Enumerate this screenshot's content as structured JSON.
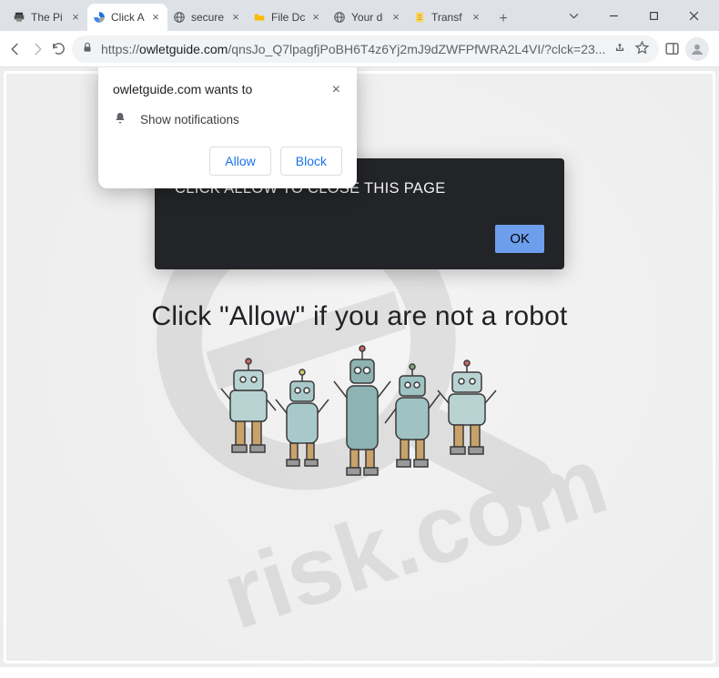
{
  "window": {
    "tabs": [
      {
        "title": "The Pi",
        "favicon": "printer"
      },
      {
        "title": "Click A",
        "favicon": "recaptcha",
        "active": true
      },
      {
        "title": "secure",
        "favicon": "globe"
      },
      {
        "title": "File Dc",
        "favicon": "folder"
      },
      {
        "title": "Your d",
        "favicon": "globe"
      },
      {
        "title": "Transf",
        "favicon": "sheet"
      }
    ],
    "controls": {
      "minimize": "–",
      "maximize": "□",
      "close": "×"
    }
  },
  "toolbar": {
    "url_protocol": "https://",
    "url_host": "owletguide.com",
    "url_path": "/qnsJo_Q7lpagfjPoBH6T4z6Yj2mJ9dZWFPfWRA2L4VI/?clck=23..."
  },
  "permission_prompt": {
    "title": "owletguide.com wants to",
    "line": "Show notifications",
    "allow": "Allow",
    "block": "Block"
  },
  "dark_modal": {
    "message": "CLICK ALLOW TO CLOSE THIS PAGE",
    "ok": "OK"
  },
  "page": {
    "headline": "Click \"Allow\"   if you are not   a robot"
  }
}
